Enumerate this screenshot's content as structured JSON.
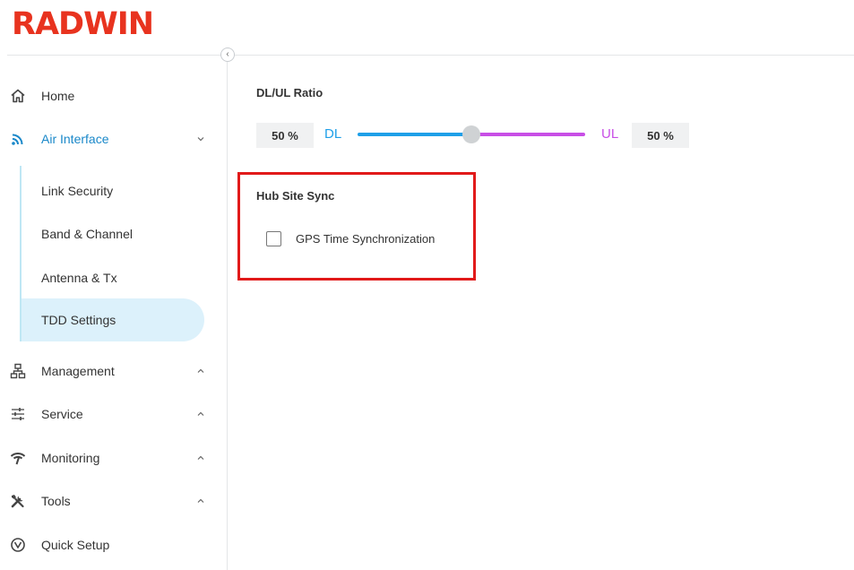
{
  "brand": {
    "logo_text": "RADWIN",
    "color": "#e8331f"
  },
  "sidebar": {
    "collapse_glyph": "‹",
    "items": [
      {
        "label": "Home",
        "icon": "home-icon"
      },
      {
        "label": "Air Interface",
        "icon": "wifi-icon",
        "expanded": true,
        "active": true,
        "children": [
          {
            "label": "Link Security"
          },
          {
            "label": "Band & Channel"
          },
          {
            "label": "Antenna & Tx"
          },
          {
            "label": "TDD Settings",
            "selected": true
          }
        ]
      },
      {
        "label": "Management",
        "icon": "network-icon",
        "expanded": false
      },
      {
        "label": "Service",
        "icon": "sliders-icon",
        "expanded": false
      },
      {
        "label": "Monitoring",
        "icon": "signal-icon",
        "expanded": false
      },
      {
        "label": "Tools",
        "icon": "tools-icon",
        "expanded": false
      },
      {
        "label": "Quick Setup",
        "icon": "quick-setup-icon"
      }
    ]
  },
  "main": {
    "ratio": {
      "title": "DL/UL Ratio",
      "dl_value": "50 %",
      "dl_label": "DL",
      "ul_label": "UL",
      "ul_value": "50 %",
      "slider_fraction": 0.5,
      "dl_color": "#1e9fe8",
      "ul_color": "#c84ee6"
    },
    "hub_sync": {
      "title": "Hub Site Sync",
      "gps_label": "GPS Time Synchronization",
      "gps_checked": false,
      "highlight_color": "#e11a1a"
    }
  },
  "colors": {
    "accent": "#1a88c9",
    "selected_bg": "#dcf1fb"
  }
}
